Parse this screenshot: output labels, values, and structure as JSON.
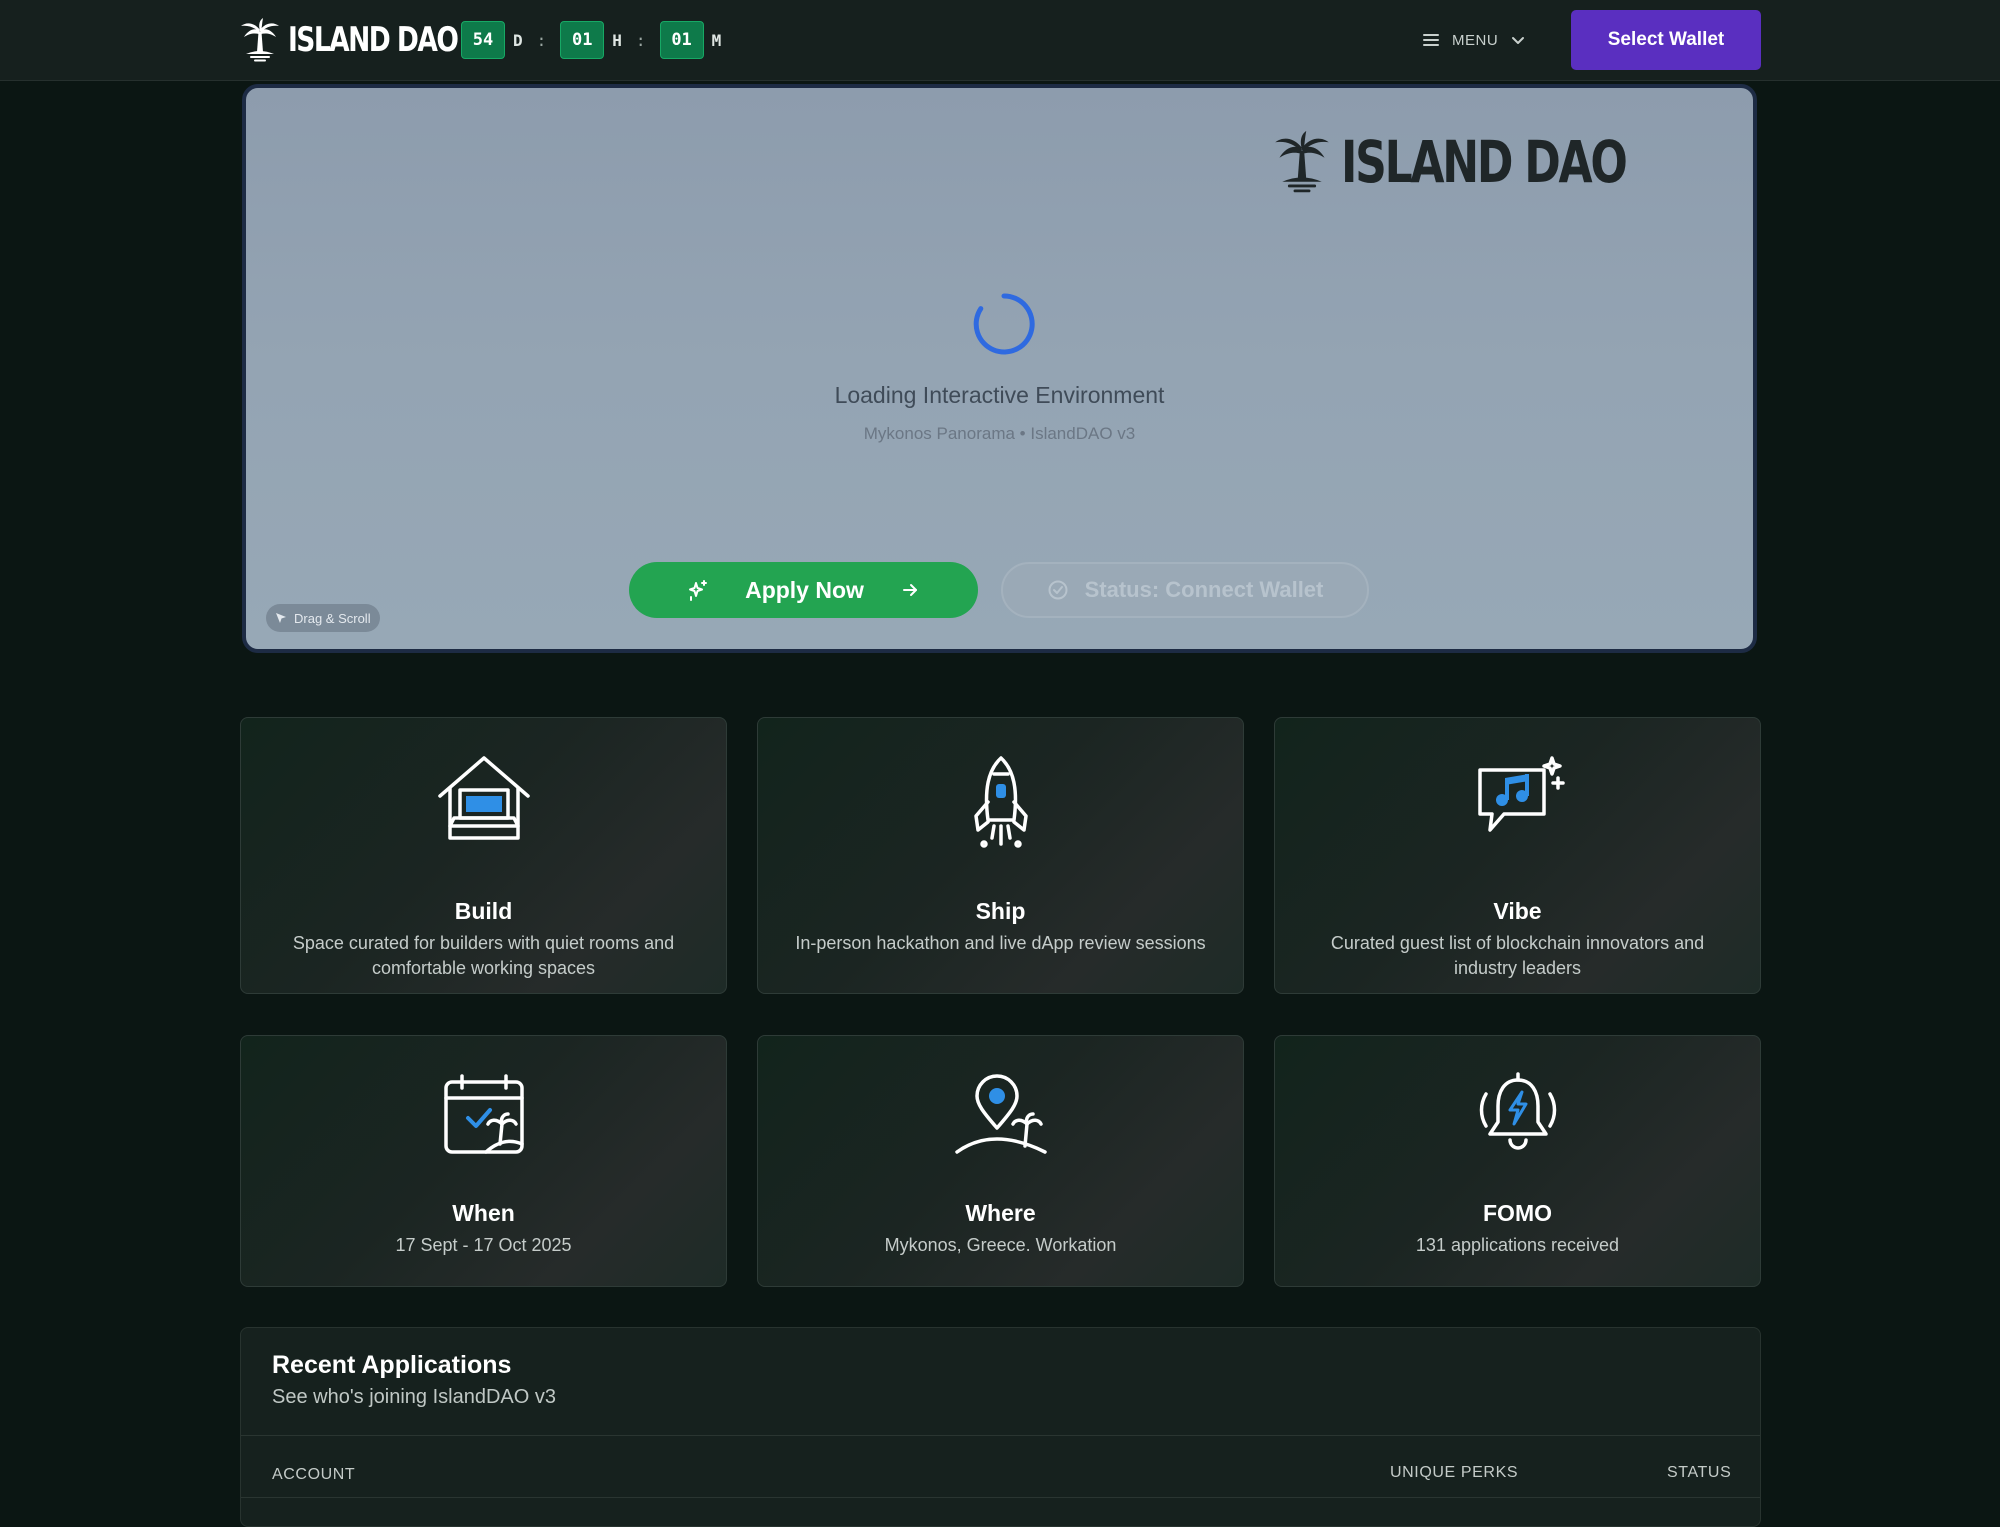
{
  "header": {
    "brand": "ISLAND DAO",
    "countdown": [
      {
        "value": "54",
        "unit": "D"
      },
      {
        "value": "01",
        "unit": "H"
      },
      {
        "value": "01",
        "unit": "M"
      }
    ],
    "countdown_sep": ":",
    "menu_label": "MENU",
    "select_wallet_label": "Select Wallet"
  },
  "hero": {
    "brand": "ISLAND DAO",
    "loading_title": "Loading Interactive Environment",
    "loading_sub": "Mykonos Panorama • IslandDAO v3",
    "apply_label": "Apply Now",
    "status_label": "Status: Connect Wallet",
    "drag_label": "Drag & Scroll",
    "colors": {
      "apply": "#23a451",
      "spinner": "#2f6ae0"
    }
  },
  "features": [
    {
      "icon": "house-laptop-icon",
      "title": "Build",
      "desc": "Space curated for builders with quiet rooms and comfortable working spaces"
    },
    {
      "icon": "rocket-icon",
      "title": "Ship",
      "desc": "In-person hackathon and live dApp review sessions"
    },
    {
      "icon": "music-chat-icon",
      "title": "Vibe",
      "desc": "Curated guest list of blockchain innovators and industry leaders"
    },
    {
      "icon": "calendar-palm-icon",
      "title": "When",
      "desc": "17 Sept - 17 Oct 2025"
    },
    {
      "icon": "location-palm-icon",
      "title": "Where",
      "desc": "Mykonos, Greece. Workation"
    },
    {
      "icon": "bell-bolt-icon",
      "title": "FOMO",
      "desc": "131 applications received"
    }
  ],
  "recent": {
    "title": "Recent Applications",
    "subtitle": "See who's joining IslandDAO v3",
    "columns": [
      "ACCOUNT",
      "UNIQUE PERKS",
      "STATUS"
    ]
  },
  "colors": {
    "accent_purple": "#5a2fc0",
    "accent_green": "#0e7a4a",
    "icon_blue": "#2f8fe6"
  }
}
